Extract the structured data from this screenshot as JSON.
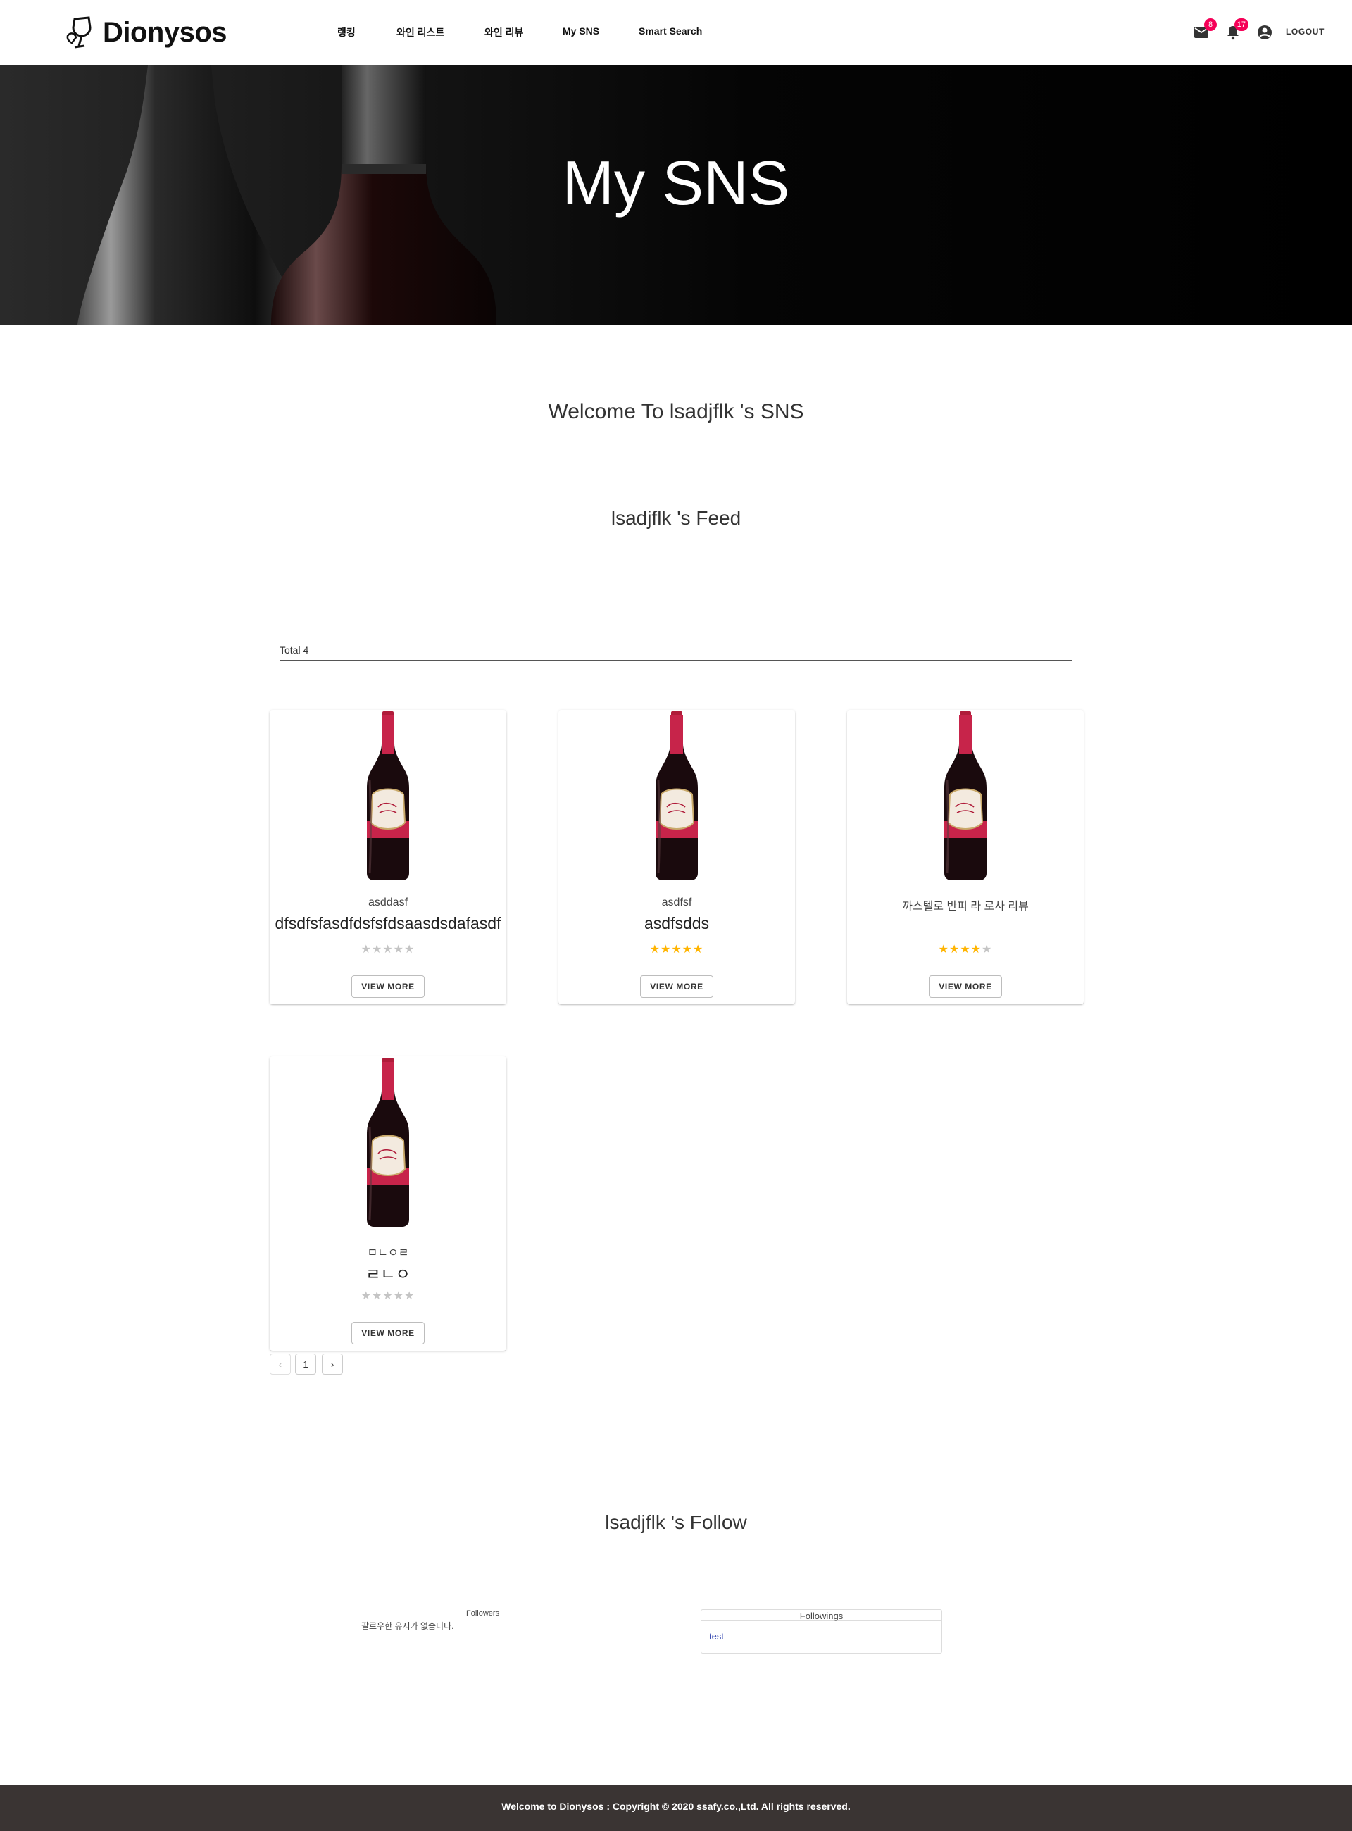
{
  "header": {
    "brand": "Dionysos",
    "nav": [
      "랭킹",
      "와인 리스트",
      "와인 리뷰",
      "My SNS",
      "Smart Search"
    ],
    "mail_badge": "8",
    "notification_badge": "17",
    "logout_label": "LOGOUT"
  },
  "hero": {
    "title": "My SNS"
  },
  "welcome": "Welcome To lsadjflk 's SNS",
  "feed": {
    "title": "lsadjflk 's Feed",
    "total_label": "Total 4",
    "cards": [
      {
        "subtitle": "asddasf",
        "title": "dfsdfsfasdfdsfsfdsaasdsdafasdf",
        "rating": 0,
        "button": "VIEW MORE"
      },
      {
        "subtitle": "asdfsf",
        "title": "asdfsdds",
        "rating": 5,
        "button": "VIEW MORE"
      },
      {
        "subtitle": "까스텔로 반피 라 로사 리뷰",
        "title": "",
        "rating": 4,
        "button": "VIEW MORE"
      },
      {
        "subtitle": "ㅁㄴㅇㄹ",
        "title": "ㄹㄴㅇ",
        "rating": 0,
        "button": "VIEW MORE"
      }
    ],
    "pagination": {
      "prev": "‹",
      "current": "1",
      "next": "›"
    }
  },
  "follow": {
    "title": "lsadjflk 's Follow",
    "followers_label": "Followers",
    "followers_empty": "팔로우한 유저가 없습니다.",
    "followings_label": "Followings",
    "followings": [
      "test"
    ]
  },
  "footer": {
    "text": "Welcome to Dionysos : Copyright © 2020 ssafy.co.,Ltd. All rights reserved."
  },
  "colors": {
    "accent_badge": "#f50057",
    "star_on": "#ffb400",
    "star_off": "#c4c4c4",
    "footer_bg": "#3a3433",
    "link": "#3f51b5"
  },
  "icons": [
    "wine-glass-logo-icon",
    "mail-icon",
    "bell-icon",
    "account-circle-icon",
    "star-icon",
    "chevron-left-icon",
    "chevron-right-icon"
  ]
}
